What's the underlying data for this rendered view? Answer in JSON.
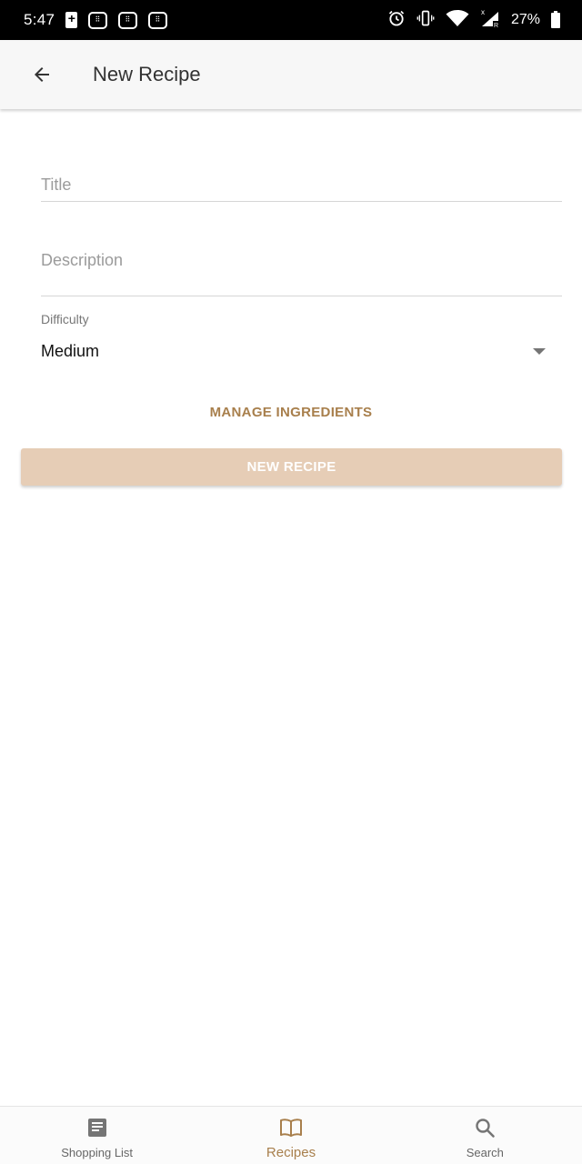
{
  "status_bar": {
    "time": "5:47",
    "battery_percent": "27%",
    "icons": [
      "battery-saver-icon",
      "notification-icon",
      "notification-icon",
      "notification-icon",
      "alarm-icon",
      "vibrate-icon",
      "wifi-icon",
      "cell-signal-icon",
      "battery-icon"
    ]
  },
  "app_bar": {
    "title": "New Recipe",
    "back_icon": "arrow-back-icon"
  },
  "form": {
    "title_placeholder": "Title",
    "title_value": "",
    "description_placeholder": "Description",
    "description_value": "",
    "difficulty_label": "Difficulty",
    "difficulty_value": "Medium",
    "manage_ingredients_label": "MANAGE INGREDIENTS",
    "submit_label": "NEW RECIPE"
  },
  "bottom_nav": {
    "items": [
      {
        "label": "Shopping List",
        "icon": "list-icon",
        "active": false
      },
      {
        "label": "Recipes",
        "icon": "book-icon",
        "active": true
      },
      {
        "label": "Search",
        "icon": "search-icon",
        "active": false
      }
    ]
  },
  "colors": {
    "accent": "#a87f4c",
    "button_disabled_bg": "#e6cdb6",
    "status_bar_bg": "#000000",
    "app_bar_bg": "#f7f7f7"
  }
}
